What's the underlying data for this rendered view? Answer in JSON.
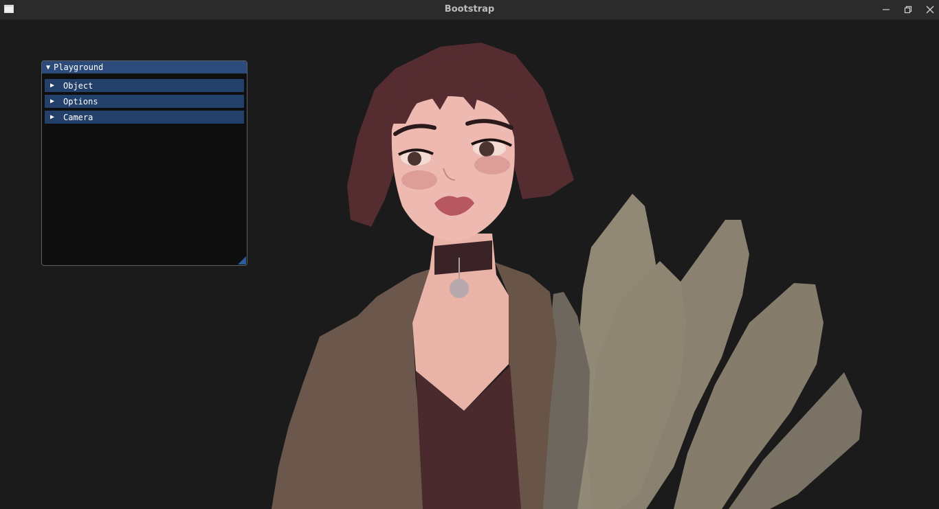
{
  "window": {
    "title": "Bootstrap",
    "icons": {
      "app": "app-window-icon",
      "minimize": "minimize-icon",
      "maximize": "restore-icon",
      "close": "close-icon"
    }
  },
  "panel": {
    "title": "Playground",
    "title_arrow": "▼",
    "sections": [
      {
        "arrow": "▶",
        "label": "Object"
      },
      {
        "arrow": "▶",
        "label": "Options"
      },
      {
        "arrow": "▶",
        "label": "Camera"
      }
    ]
  },
  "colors": {
    "background": "#1b1b1b",
    "titlebar": "#2b2b2b",
    "panel_title": "#2c4a7a",
    "panel_header": "#22406a"
  }
}
